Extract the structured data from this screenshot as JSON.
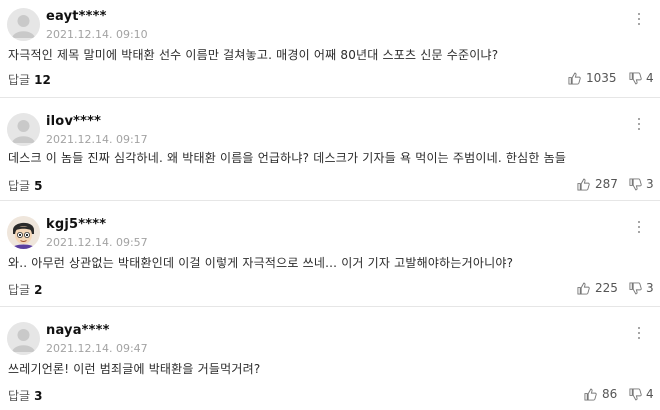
{
  "labels": {
    "reply": "답글"
  },
  "comments": [
    {
      "nickname": "eayt****",
      "date": "2021.12.14. 09:10",
      "text": "자극적인 제목 말미에 박태환 선수 이름만 걸쳐놓고. 매경이 어째 80년대 스포츠 신문 수준이냐?",
      "replies": "12",
      "likes": "1035",
      "dislikes": "4",
      "avatar": "default"
    },
    {
      "nickname": "ilov****",
      "date": "2021.12.14. 09:17",
      "text": "데스크 이 놈들 진짜 심각하네. 왜 박태환 이름을 언급하냐? 데스크가 기자들 욕 먹이는 주범이네. 한심한 놈들",
      "replies": "5",
      "likes": "287",
      "dislikes": "3",
      "avatar": "default"
    },
    {
      "nickname": "kgj5****",
      "date": "2021.12.14. 09:57",
      "text": "와.. 아무런 상관없는 박태환인데 이걸 이렇게 자극적으로 쓰네... 이거 기자 고발해야하는거아니야?",
      "replies": "2",
      "likes": "225",
      "dislikes": "3",
      "avatar": "cartoon"
    },
    {
      "nickname": "naya****",
      "date": "2021.12.14. 09:47",
      "text": "쓰레기언론! 이런 범죄글에 박태환을 거들먹거려?",
      "replies": "3",
      "likes": "86",
      "dislikes": "4",
      "avatar": "default"
    }
  ]
}
